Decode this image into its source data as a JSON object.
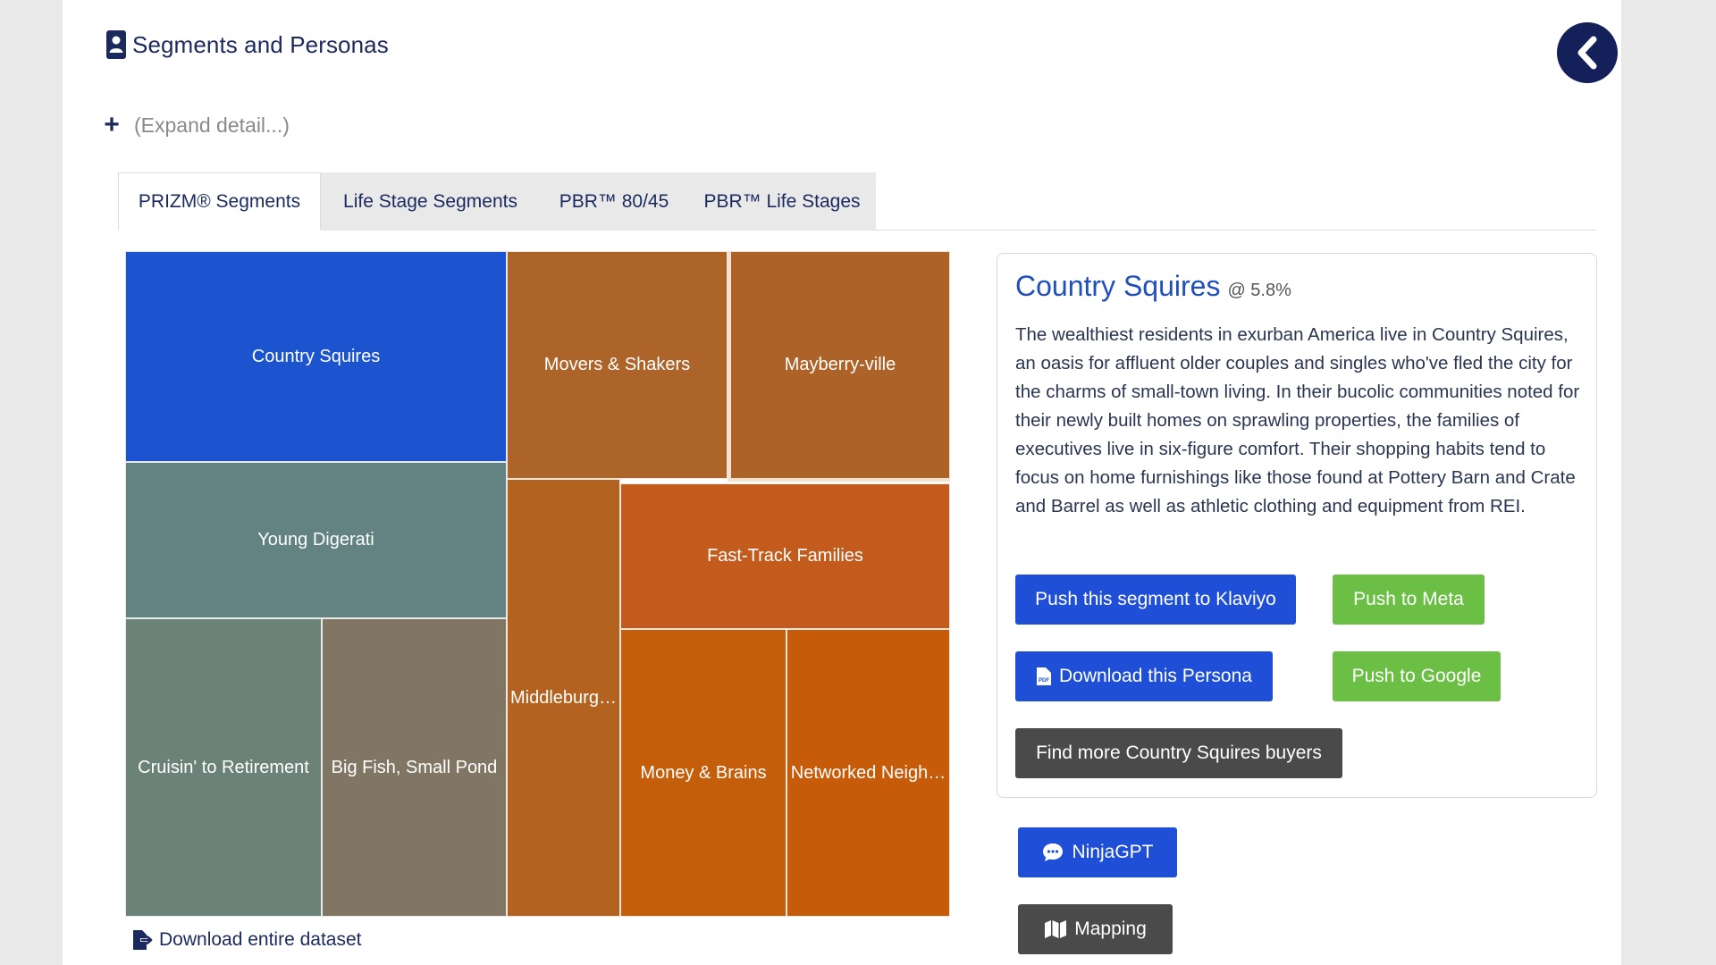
{
  "header": {
    "title": "Segments and Personas",
    "title_icon": "id-badge-icon",
    "back_icon": "chevron-left-icon"
  },
  "expand": {
    "icon": "plus-icon",
    "label": "(Expand detail...)"
  },
  "tabs": [
    {
      "label": "PRIZM® Segments",
      "active": true
    },
    {
      "label": "Life Stage Segments",
      "active": false
    },
    {
      "label": "PBR™ 80/45",
      "active": false
    },
    {
      "label": "PBR™ Life Stages",
      "active": false
    }
  ],
  "treemap": {
    "cells": [
      {
        "label": "Country Squires",
        "color": "#1c54d0"
      },
      {
        "label": "Movers & Shakers",
        "color": "#ac6429"
      },
      {
        "label": "Mayberry-ville",
        "color": "#ad6328"
      },
      {
        "label": "Young Digerati",
        "color": "#638383"
      },
      {
        "label": "Fast-Track Families",
        "color": "#c25b1c"
      },
      {
        "label": "Middleburg…",
        "color": "#b3621f"
      },
      {
        "label": "Cruisin' to Retirement",
        "color": "#6b8278"
      },
      {
        "label": "Big Fish, Small Pond",
        "color": "#807663"
      },
      {
        "label": "Money & Brains",
        "color": "#c55e0a"
      },
      {
        "label": "Networked Neigh…",
        "color": "#c65c0a"
      }
    ],
    "download_label": "Download entire dataset",
    "download_icon": "file-export-icon"
  },
  "detail": {
    "title": "Country Squires",
    "percent": "@ 5.8%",
    "description": "The wealthiest residents in exurban America live in Country Squires, an oasis for affluent older couples and singles who've fled the city for the charms of small-town living. In their bucolic communities noted for their newly built homes on sprawling properties, the families of executives live in six-figure comfort. Their shopping habits tend to focus on home furnishings like those found at Pottery Barn and Crate and Barrel as well as athletic clothing and equipment from REI.",
    "buttons": {
      "klaviyo": "Push this segment to Klaviyo",
      "meta": "Push to Meta",
      "download_persona": "Download this Persona",
      "google": "Push to Google",
      "find_more": "Find more Country Squires buyers"
    },
    "pdf_icon": "file-pdf-icon"
  },
  "side_actions": {
    "ninja": "NinjaGPT",
    "ninja_icon": "chat-bubble-icon",
    "mapping": "Mapping",
    "mapping_icon": "map-icon"
  },
  "colors": {
    "brand_navy": "#13205a",
    "primary_blue": "#1e4fd6",
    "success_green": "#6bbf45",
    "dark_gray": "#4a4a4a"
  }
}
